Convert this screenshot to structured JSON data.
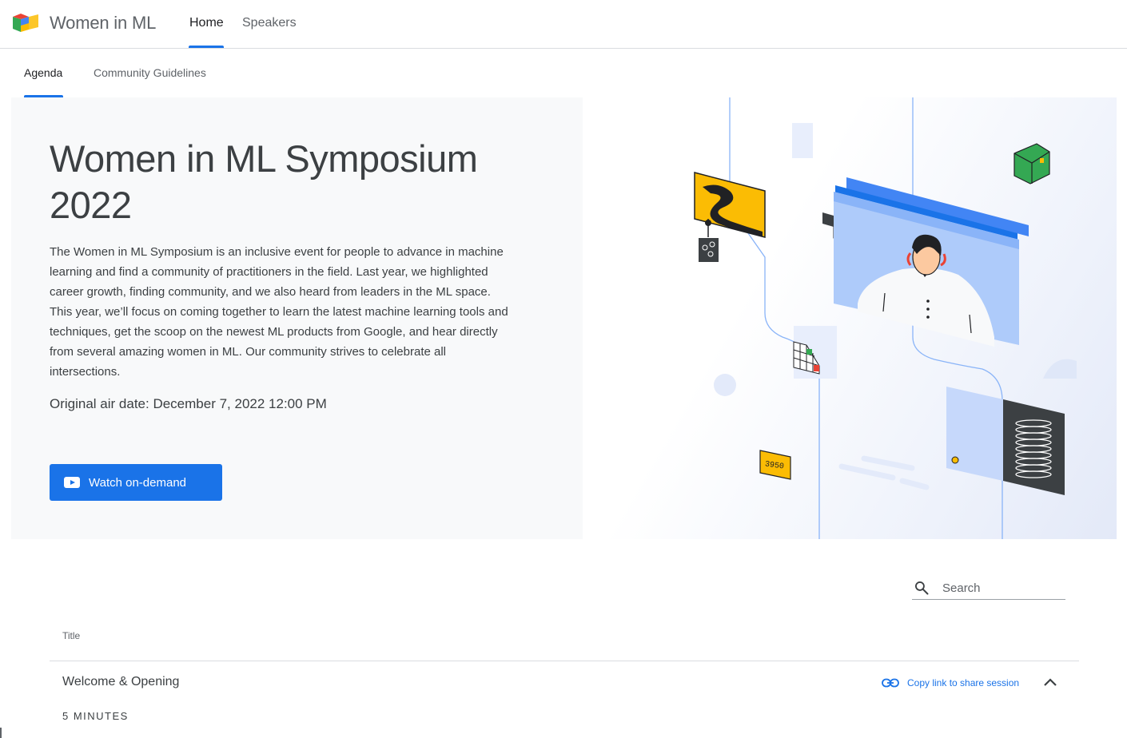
{
  "header": {
    "brand": "Women in ML",
    "nav": [
      {
        "label": "Home",
        "active": true
      },
      {
        "label": "Speakers",
        "active": false
      }
    ]
  },
  "subtabs": [
    {
      "label": "Agenda",
      "active": true
    },
    {
      "label": "Community Guidelines",
      "active": false
    }
  ],
  "hero": {
    "title": "Women in ML Symposium 2022",
    "description": "The Women in ML Symposium is an inclusive event for people to advance in machine learning and find a community of practitioners in the field. Last year, we highlighted career growth, finding community, and we also heard from leaders in the ML space. This year, we’ll focus on coming together to learn the latest machine learning tools and techniques, get the scoop on the newest ML products from Google, and hear directly from several amazing women in ML. Our community strives to celebrate all intersections.",
    "air_date": "Original air date: December 7, 2022 12:00 PM",
    "watch_label": "Watch on-demand",
    "illustration_tag": "3950"
  },
  "search": {
    "placeholder": "Search"
  },
  "agenda": {
    "column_title": "Title",
    "sessions": [
      {
        "title": "Welcome & Opening",
        "copy_link_label": "Copy link to share session",
        "duration": "5 MINUTES"
      }
    ]
  },
  "colors": {
    "accent": "#1a73e8",
    "hero_panel": "#f8f9fa",
    "text": "#3c4043",
    "illustration_yellow": "#fbbc04",
    "illustration_green": "#34a853",
    "illustration_red": "#ea4335"
  }
}
